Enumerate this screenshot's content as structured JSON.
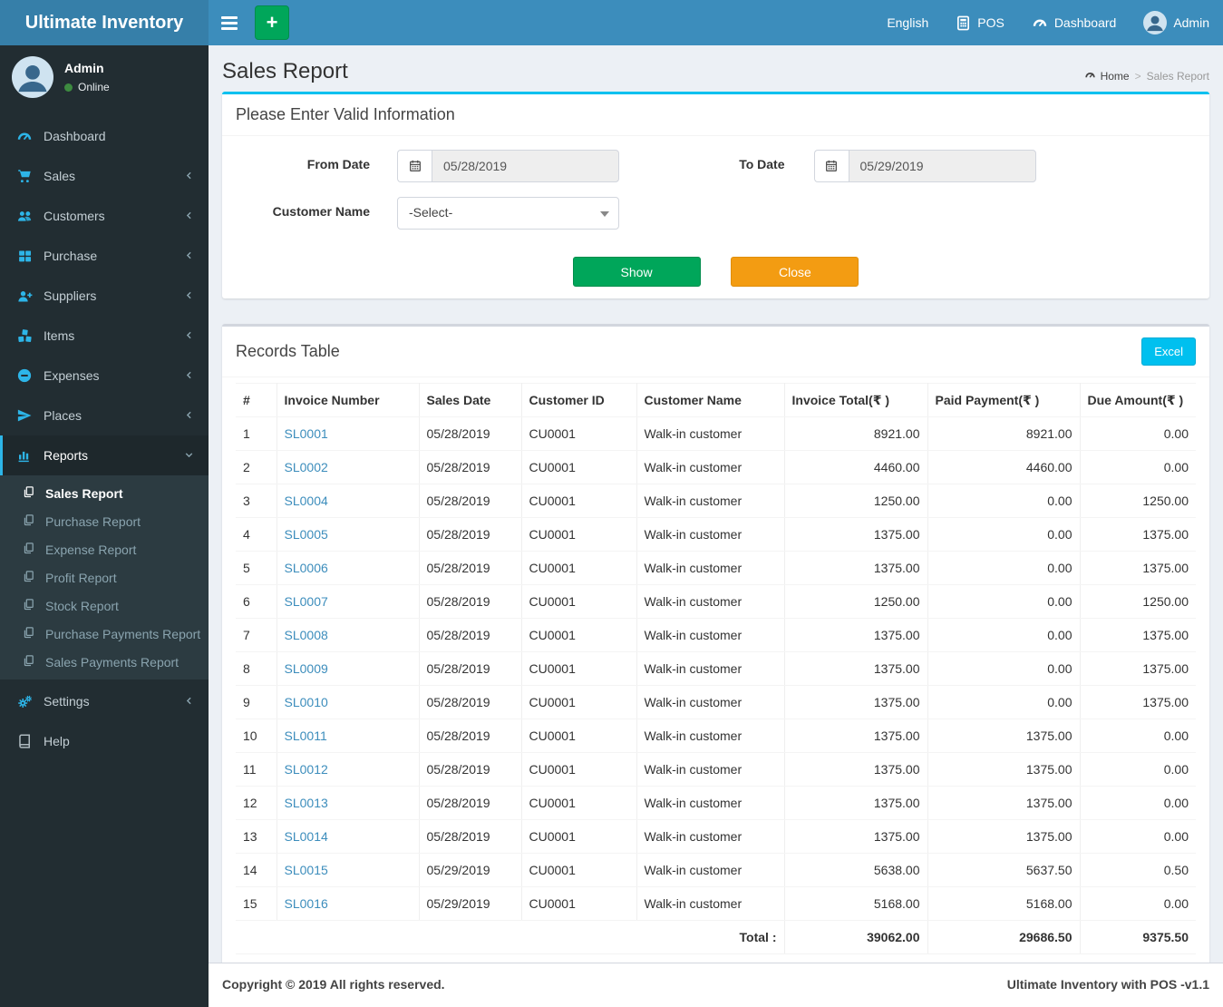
{
  "brand": {
    "title": "Ultimate Inventory"
  },
  "navbar": {
    "language": "English",
    "pos": "POS",
    "dashboard": "Dashboard",
    "user": "Admin"
  },
  "sidebar": {
    "user": {
      "name": "Admin",
      "status": "Online"
    },
    "items": [
      {
        "label": "Dashboard",
        "icon": "gauge-icon",
        "chevron": "none"
      },
      {
        "label": "Sales",
        "icon": "cart-icon",
        "chevron": "left"
      },
      {
        "label": "Customers",
        "icon": "users-icon",
        "chevron": "left"
      },
      {
        "label": "Purchase",
        "icon": "grid-icon",
        "chevron": "left"
      },
      {
        "label": "Suppliers",
        "icon": "user-plus-icon",
        "chevron": "left"
      },
      {
        "label": "Items",
        "icon": "cubes-icon",
        "chevron": "left"
      },
      {
        "label": "Expenses",
        "icon": "minus-circle-icon",
        "chevron": "left"
      },
      {
        "label": "Places",
        "icon": "paper-plane-icon",
        "chevron": "left"
      },
      {
        "label": "Reports",
        "icon": "bar-chart-icon",
        "chevron": "down",
        "active": true
      }
    ],
    "reports_submenu": {
      "active_index": 0,
      "items": [
        "Sales Report",
        "Purchase Report",
        "Expense Report",
        "Profit Report",
        "Stock Report",
        "Purchase Payments Report",
        "Sales Payments Report"
      ]
    },
    "settings": {
      "label": "Settings",
      "icon": "gears-icon",
      "chevron": "left"
    },
    "help": {
      "label": "Help",
      "icon": "book-icon",
      "chevron": "none"
    }
  },
  "page": {
    "title": "Sales Report",
    "breadcrumb": {
      "home": "Home",
      "separator": ">",
      "current": "Sales Report"
    }
  },
  "filter": {
    "panel_title": "Please Enter Valid Information",
    "from_date": {
      "label": "From Date",
      "value": "05/28/2019"
    },
    "to_date": {
      "label": "To Date",
      "value": "05/29/2019"
    },
    "customer": {
      "label": "Customer Name",
      "value": "-Select-"
    },
    "show_label": "Show",
    "close_label": "Close"
  },
  "records": {
    "panel_title": "Records Table",
    "excel_label": "Excel",
    "columns": [
      "#",
      "Invoice Number",
      "Sales Date",
      "Customer ID",
      "Customer Name",
      "Invoice Total(₹ )",
      "Paid Payment(₹ )",
      "Due Amount(₹ )"
    ],
    "rows": [
      {
        "sn": "1",
        "invoice": "SL0001",
        "date": "05/28/2019",
        "customer_id": "CU0001",
        "customer_name": "Walk-in customer",
        "invoice_total": "8921.00",
        "paid_payment": "8921.00",
        "due_amount": "0.00"
      },
      {
        "sn": "2",
        "invoice": "SL0002",
        "date": "05/28/2019",
        "customer_id": "CU0001",
        "customer_name": "Walk-in customer",
        "invoice_total": "4460.00",
        "paid_payment": "4460.00",
        "due_amount": "0.00"
      },
      {
        "sn": "3",
        "invoice": "SL0004",
        "date": "05/28/2019",
        "customer_id": "CU0001",
        "customer_name": "Walk-in customer",
        "invoice_total": "1250.00",
        "paid_payment": "0.00",
        "due_amount": "1250.00"
      },
      {
        "sn": "4",
        "invoice": "SL0005",
        "date": "05/28/2019",
        "customer_id": "CU0001",
        "customer_name": "Walk-in customer",
        "invoice_total": "1375.00",
        "paid_payment": "0.00",
        "due_amount": "1375.00"
      },
      {
        "sn": "5",
        "invoice": "SL0006",
        "date": "05/28/2019",
        "customer_id": "CU0001",
        "customer_name": "Walk-in customer",
        "invoice_total": "1375.00",
        "paid_payment": "0.00",
        "due_amount": "1375.00"
      },
      {
        "sn": "6",
        "invoice": "SL0007",
        "date": "05/28/2019",
        "customer_id": "CU0001",
        "customer_name": "Walk-in customer",
        "invoice_total": "1250.00",
        "paid_payment": "0.00",
        "due_amount": "1250.00"
      },
      {
        "sn": "7",
        "invoice": "SL0008",
        "date": "05/28/2019",
        "customer_id": "CU0001",
        "customer_name": "Walk-in customer",
        "invoice_total": "1375.00",
        "paid_payment": "0.00",
        "due_amount": "1375.00"
      },
      {
        "sn": "8",
        "invoice": "SL0009",
        "date": "05/28/2019",
        "customer_id": "CU0001",
        "customer_name": "Walk-in customer",
        "invoice_total": "1375.00",
        "paid_payment": "0.00",
        "due_amount": "1375.00"
      },
      {
        "sn": "9",
        "invoice": "SL0010",
        "date": "05/28/2019",
        "customer_id": "CU0001",
        "customer_name": "Walk-in customer",
        "invoice_total": "1375.00",
        "paid_payment": "0.00",
        "due_amount": "1375.00"
      },
      {
        "sn": "10",
        "invoice": "SL0011",
        "date": "05/28/2019",
        "customer_id": "CU0001",
        "customer_name": "Walk-in customer",
        "invoice_total": "1375.00",
        "paid_payment": "1375.00",
        "due_amount": "0.00"
      },
      {
        "sn": "11",
        "invoice": "SL0012",
        "date": "05/28/2019",
        "customer_id": "CU0001",
        "customer_name": "Walk-in customer",
        "invoice_total": "1375.00",
        "paid_payment": "1375.00",
        "due_amount": "0.00"
      },
      {
        "sn": "12",
        "invoice": "SL0013",
        "date": "05/28/2019",
        "customer_id": "CU0001",
        "customer_name": "Walk-in customer",
        "invoice_total": "1375.00",
        "paid_payment": "1375.00",
        "due_amount": "0.00"
      },
      {
        "sn": "13",
        "invoice": "SL0014",
        "date": "05/28/2019",
        "customer_id": "CU0001",
        "customer_name": "Walk-in customer",
        "invoice_total": "1375.00",
        "paid_payment": "1375.00",
        "due_amount": "0.00"
      },
      {
        "sn": "14",
        "invoice": "SL0015",
        "date": "05/29/2019",
        "customer_id": "CU0001",
        "customer_name": "Walk-in customer",
        "invoice_total": "5638.00",
        "paid_payment": "5637.50",
        "due_amount": "0.50"
      },
      {
        "sn": "15",
        "invoice": "SL0016",
        "date": "05/29/2019",
        "customer_id": "CU0001",
        "customer_name": "Walk-in customer",
        "invoice_total": "5168.00",
        "paid_payment": "5168.00",
        "due_amount": "0.00"
      }
    ],
    "total_label": "Total :",
    "totals": {
      "invoice_total": "39062.00",
      "paid_payment": "29686.50",
      "due_amount": "9375.50"
    }
  },
  "footer": {
    "left": "Copyright © 2019 All rights reserved.",
    "right": "Ultimate Inventory with POS -v1.1"
  },
  "colors": {
    "navbar": "#3c8dbc",
    "logo_bg": "#367fa9",
    "sidebar_bg": "#222d32",
    "submenu_bg": "#2c3b41",
    "sidebar_icon_accent": "#2db5e8",
    "panel_info_border": "#00c0ef",
    "show_button": "#00a65a",
    "close_button": "#f39c12",
    "excel_button": "#00c0ef",
    "link": "#3c8dbc",
    "online_dot": "#3d8b40"
  }
}
